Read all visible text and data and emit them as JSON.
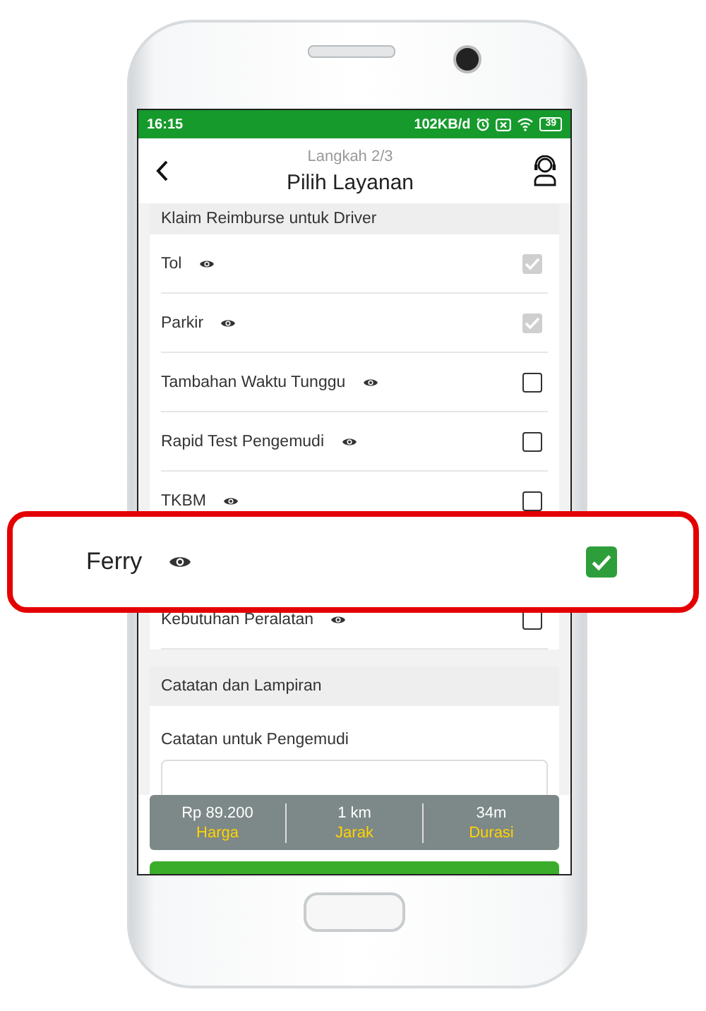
{
  "status_bar": {
    "time": "16:15",
    "speed": "102KB/d",
    "battery": "39"
  },
  "header": {
    "step": "Langkah 2/3",
    "title": "Pilih Layanan"
  },
  "reimburse": {
    "title": "Klaim Reimburse untuk Driver",
    "items": [
      {
        "kind": "row",
        "label": "Tol",
        "checked": true,
        "disabled": true
      },
      {
        "kind": "row",
        "label": "Parkir",
        "checked": true,
        "disabled": true
      },
      {
        "kind": "row",
        "label": "Tambahan Waktu Tunggu",
        "checked": false,
        "disabled": false
      },
      {
        "kind": "row",
        "label": "Rapid Test Pengemudi",
        "checked": false,
        "disabled": false
      },
      {
        "kind": "row",
        "label": "TKBM",
        "checked": false,
        "disabled": false
      },
      {
        "kind": "callout",
        "label": "Ferry",
        "checked": true
      },
      {
        "kind": "row",
        "label": "Kebutuhan Peralatan",
        "checked": false,
        "disabled": false
      }
    ]
  },
  "notes": {
    "title": "Catatan dan Lampiran",
    "label": "Catatan untuk Pengemudi"
  },
  "summary": [
    {
      "value": "Rp 89.200",
      "label": "Harga"
    },
    {
      "value": "1 km",
      "label": "Jarak"
    },
    {
      "value": "34m",
      "label": "Durasi"
    }
  ]
}
